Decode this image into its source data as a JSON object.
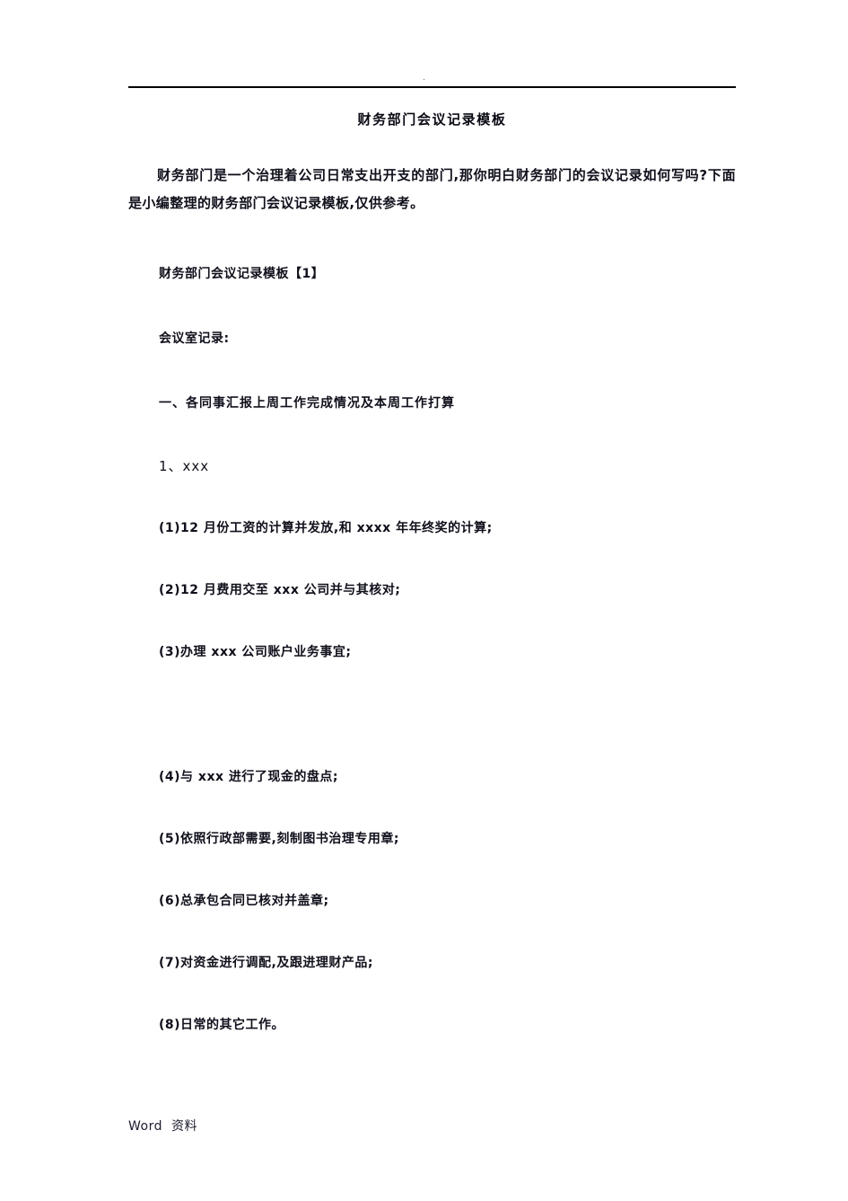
{
  "header": {
    "mark": "."
  },
  "document": {
    "title": "财务部门会议记录模板",
    "intro": "财务部门是一个治理着公司日常支出开支的部门,那你明白财务部门的会议记录如何写吗?下面是小编整理的财务部门会议记录模板,仅供参考。",
    "template_label": "财务部门会议记录模板【1】",
    "record_label": "会议室记录:",
    "section_heading": "一、各同事汇报上周工作完成情况及本周工作打算",
    "item_1": "1、xxx",
    "sub_items": [
      "(1)12 月份工资的计算并发放,和 xxxx 年年终奖的计算;",
      "(2)12 月费用交至 xxx 公司并与其核对;",
      "(3)办理 xxx 公司账户业务事宜;",
      "(4)与 xxx 进行了现金的盘点;",
      "(5)依照行政部需要,刻制图书治理专用章;",
      "(6)总承包合同已核对并盖章;",
      "(7)对资金进行调配,及跟进理财产品;",
      "(8)日常的其它工作。"
    ]
  },
  "footer": {
    "word_label": "Word",
    "material_label": "资料"
  }
}
